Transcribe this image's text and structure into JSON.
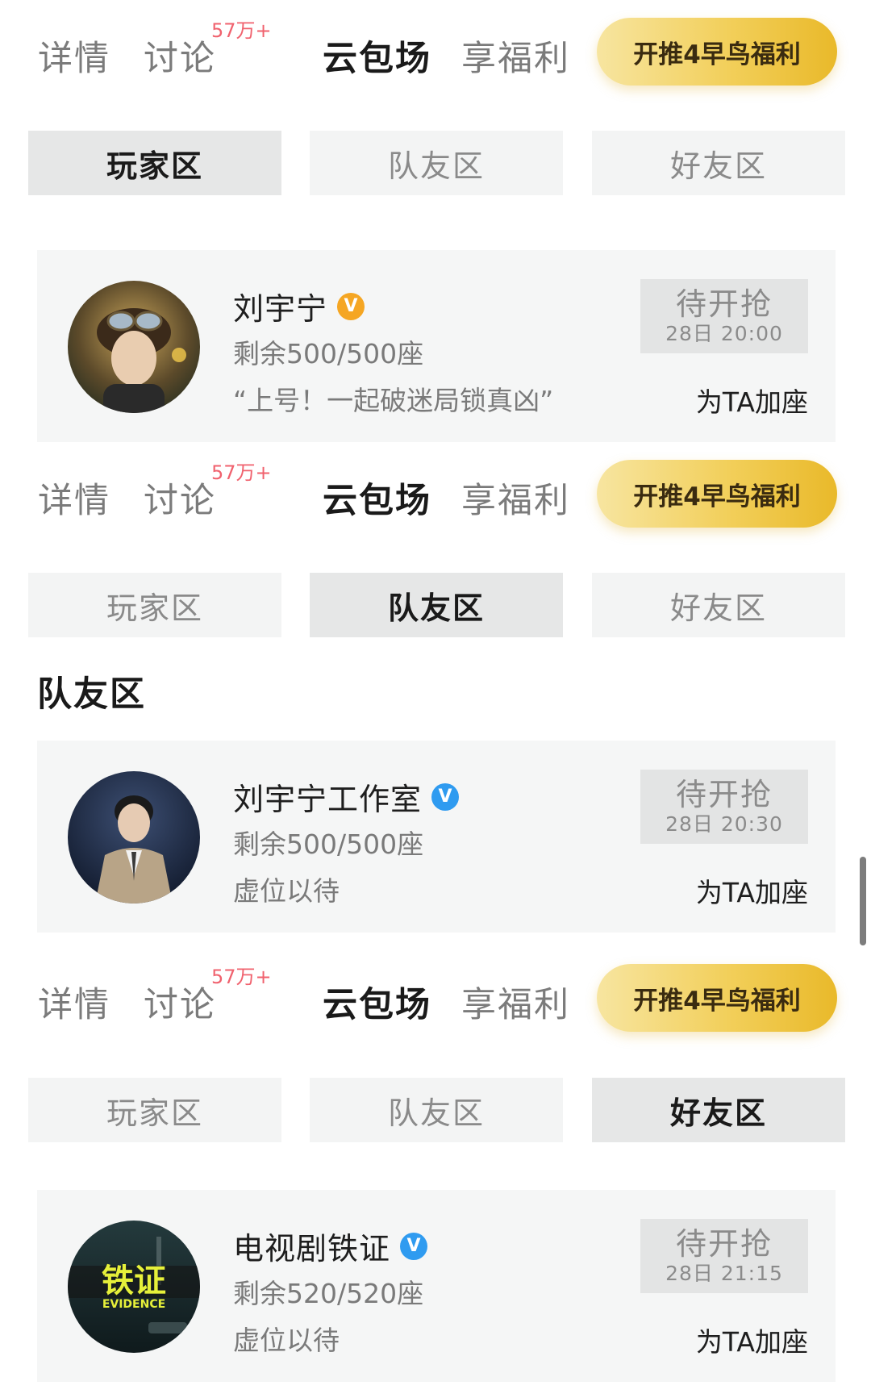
{
  "panels": [
    {
      "nav": {
        "tabs": [
          "详情",
          "讨论",
          "云包场",
          "享福利"
        ],
        "active_tab": "云包场",
        "discuss_badge": "57万+",
        "promo_button": "开推4早鸟福利"
      },
      "zones": [
        "玩家区",
        "队友区",
        "好友区"
      ],
      "active_zone": "玩家区",
      "section_title": "",
      "card": {
        "name": "刘宇宁",
        "verified_color": "#f5a623",
        "seats": "剩余500/500座",
        "slogan": "“上号！一起破迷局锁真凶”",
        "status_label": "待开抢",
        "status_time": "28日 20:00",
        "action": "为TA加座",
        "avatar_desc_icon": "avatar-character-portrait"
      }
    },
    {
      "nav": {
        "tabs": [
          "详情",
          "讨论",
          "云包场",
          "享福利"
        ],
        "active_tab": "云包场",
        "discuss_badge": "57万+",
        "promo_button": "开推4早鸟福利"
      },
      "zones": [
        "玩家区",
        "队友区",
        "好友区"
      ],
      "active_zone": "队友区",
      "section_title": "队友区",
      "card": {
        "name": "刘宇宁工作室",
        "verified_color": "#2f9bf0",
        "seats": "剩余500/500座",
        "slogan": "虚位以待",
        "status_label": "待开抢",
        "status_time": "28日 20:30",
        "action": "为TA加座",
        "avatar_desc_icon": "avatar-studio-portrait"
      }
    },
    {
      "nav": {
        "tabs": [
          "详情",
          "讨论",
          "云包场",
          "享福利"
        ],
        "active_tab": "云包场",
        "discuss_badge": "57万+",
        "promo_button": "开推4早鸟福利"
      },
      "zones": [
        "玩家区",
        "队友区",
        "好友区"
      ],
      "active_zone": "好友区",
      "section_title": "",
      "card": {
        "name": "电视剧铁证",
        "verified_color": "#2f9bf0",
        "seats": "剩余520/520座",
        "slogan": "虚位以待",
        "status_label": "待开抢",
        "status_time": "28日 21:15",
        "action": "为TA加座",
        "avatar_desc_icon": "avatar-drama-poster",
        "avatar_text": "铁证",
        "avatar_subtext": "EVIDENCE"
      }
    }
  ],
  "verified_glyph": "V"
}
